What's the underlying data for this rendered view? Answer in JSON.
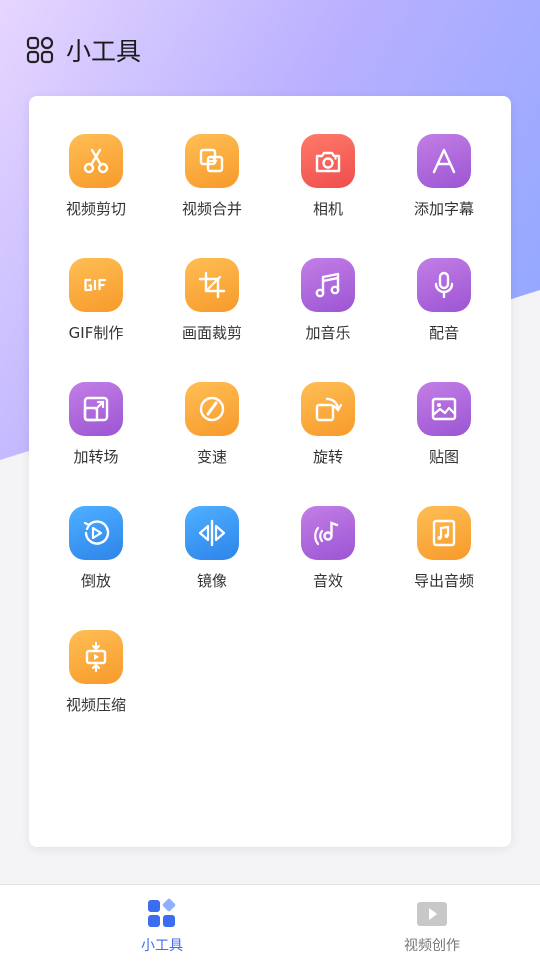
{
  "header": {
    "title": "小工具",
    "icon": "grid-icon"
  },
  "tools": [
    {
      "label": "视频剪切",
      "icon": "scissors-icon",
      "color": "orange"
    },
    {
      "label": "视频合并",
      "icon": "merge-icon",
      "color": "orange"
    },
    {
      "label": "相机",
      "icon": "camera-icon",
      "color": "red"
    },
    {
      "label": "添加字幕",
      "icon": "text-icon",
      "color": "purple"
    },
    {
      "label": "GIF制作",
      "icon": "gif-icon",
      "color": "orange"
    },
    {
      "label": "画面裁剪",
      "icon": "crop-icon",
      "color": "orange"
    },
    {
      "label": "加音乐",
      "icon": "music-icon",
      "color": "purple"
    },
    {
      "label": "配音",
      "icon": "microphone-icon",
      "color": "purple"
    },
    {
      "label": "加转场",
      "icon": "transition-icon",
      "color": "purple"
    },
    {
      "label": "变速",
      "icon": "speed-icon",
      "color": "orange"
    },
    {
      "label": "旋转",
      "icon": "rotate-icon",
      "color": "orange"
    },
    {
      "label": "贴图",
      "icon": "image-icon",
      "color": "purple"
    },
    {
      "label": "倒放",
      "icon": "reverse-icon",
      "color": "blue"
    },
    {
      "label": "镜像",
      "icon": "mirror-icon",
      "color": "blue"
    },
    {
      "label": "音效",
      "icon": "sound-effect-icon",
      "color": "purple"
    },
    {
      "label": "导出音频",
      "icon": "export-audio-icon",
      "color": "orange"
    },
    {
      "label": "视频压缩",
      "icon": "compress-icon",
      "color": "orange"
    }
  ],
  "bottom_nav": [
    {
      "label": "小工具",
      "icon": "tools-grid-icon",
      "active": true
    },
    {
      "label": "视频创作",
      "icon": "video-play-icon",
      "active": false
    }
  ],
  "colors": {
    "accent": "#3c6df0",
    "orange": "#f79a2a",
    "red": "#ef4d4d",
    "purple": "#9c55d3",
    "blue": "#2d84ea"
  }
}
